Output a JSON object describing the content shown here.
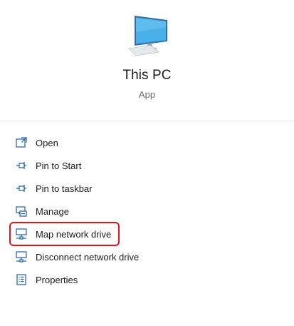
{
  "app": {
    "title": "This PC",
    "subtitle": "App"
  },
  "menu": {
    "items": [
      {
        "label": "Open",
        "icon": "open-icon"
      },
      {
        "label": "Pin to Start",
        "icon": "pin-icon"
      },
      {
        "label": "Pin to taskbar",
        "icon": "pin-icon"
      },
      {
        "label": "Manage",
        "icon": "manage-icon"
      },
      {
        "label": "Map network drive",
        "icon": "network-drive-icon",
        "highlighted": true
      },
      {
        "label": "Disconnect network drive",
        "icon": "network-drive-icon"
      },
      {
        "label": "Properties",
        "icon": "properties-icon"
      }
    ]
  },
  "colors": {
    "accent_icon": "#1f5fa8",
    "highlight_border": "#e0151c",
    "monitor_screen": "#4ab0ea"
  }
}
